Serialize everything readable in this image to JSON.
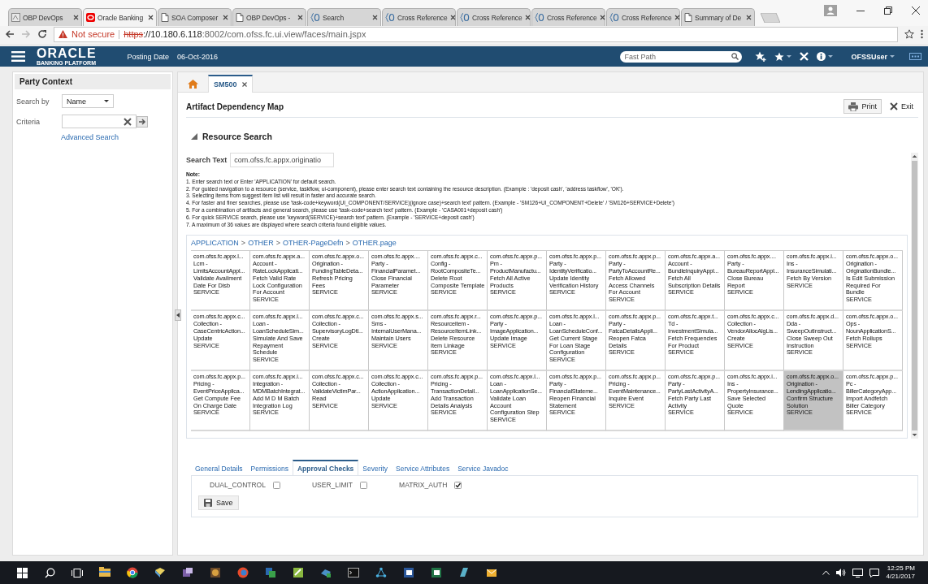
{
  "browser": {
    "tabs": [
      {
        "title": "OBP DevOps",
        "kind": "generic",
        "selected": false
      },
      {
        "title": "Oracle Banking",
        "kind": "oracle",
        "selected": true
      },
      {
        "title": "SOA Composer",
        "kind": "page",
        "selected": false
      },
      {
        "title": "OBP DevOps -",
        "kind": "page",
        "selected": false
      },
      {
        "title": "Search",
        "kind": "brace",
        "selected": false
      },
      {
        "title": "Cross Reference",
        "kind": "brace",
        "selected": false
      },
      {
        "title": "Cross Reference",
        "kind": "brace",
        "selected": false
      },
      {
        "title": "Cross Reference",
        "kind": "brace",
        "selected": false
      },
      {
        "title": "Cross Reference",
        "kind": "brace",
        "selected": false
      },
      {
        "title": "Summary of De",
        "kind": "page",
        "selected": false
      }
    ],
    "security_warning": "Not secure",
    "url_scheme": "https",
    "url_host": "://10.180.6.118",
    "url_path": ":8002/com.ofss.fc.ui.view/faces/main.jspx"
  },
  "app_header": {
    "logo": "ORACLE",
    "logo_subtitle": "BANKING PLATFORM",
    "posting_date_label": "Posting Date",
    "posting_date": "06-Oct-2016",
    "fast_path": {
      "placeholder": "Fast Path"
    },
    "user": "OFSSUser"
  },
  "party_context": {
    "title": "Party Context",
    "search_by_label": "Search by",
    "search_by_value": "Name",
    "criteria_label": "Criteria",
    "advanced_search": "Advanced Search"
  },
  "workspace_tabs": [
    {
      "kind": "home",
      "selected": false
    },
    {
      "kind": "page",
      "label": "SM500",
      "selected": true
    }
  ],
  "page": {
    "title": "Artifact Dependency Map",
    "buttons": [
      {
        "label": "Print",
        "kind": "print"
      },
      {
        "label": "Exit",
        "kind": "exit"
      }
    ],
    "section": {
      "title": "Resource Search",
      "expanded": true
    },
    "search_text": {
      "label": "Search Text",
      "value": "com.ofss.fc.appx.originatio"
    },
    "note_heading": "Note:",
    "notes": [
      "1. Enter search text or Enter 'APPLICATION' for default search.",
      "2. For guided navigation to a resource (service, taskflow, ui-component), please enter search text containing the resource description. (Example : 'deposit cash', 'address taskflow', 'OK').",
      "3. Selecting items from suggest item list will result in faster and accurate search.",
      "4. For faster and finer searches, please use 'task-code+keyword(UI_COMPONENT/SERVICE)(ignore case)+search text' pattern. (Example - 'SM126+UI_COMPONENT+Delete' / 'SM126+SERVICE+Delete')",
      "5. For a combination of artifacts and general search, please use 'task-code+search text' pattern. (Example - 'CASA001+deposit cash')",
      "6. For quick SERVICE search, please use 'keyword(SERVICE)+search text' pattern. (Example - 'SERVICE+deposit cash')",
      "7. A maximum of 36 values are displayed where search criteria found eligible values."
    ],
    "breadcrumb": {
      "items": [
        "APPLICATION",
        "OTHER",
        "OTHER-PageDefn",
        "OTHER.page"
      ],
      "separator": ">"
    },
    "artifacts": [
      {
        "package": "com.ofss.fc.appx.l...",
        "module": "Lcm -",
        "component": "LimitsAccountAppl...",
        "operation": "Validate Availment Date For Disb",
        "type": "SERVICE",
        "selected": false
      },
      {
        "package": "com.ofss.fc.appx.a...",
        "module": "Account -",
        "component": "RateLockApplicati...",
        "operation": "Fetch Valid Rate Lock Configuration For Account",
        "type": "SERVICE",
        "selected": false
      },
      {
        "package": "com.ofss.fc.appx.o...",
        "module": "Origination -",
        "component": "FundingTableDeta...",
        "operation": "Refresh Pricing Fees",
        "type": "SERVICE",
        "selected": false
      },
      {
        "package": "com.ofss.fc.appx....",
        "module": "Party -",
        "component": "FinancialParamet...",
        "operation": "Close Financial Parameter",
        "type": "SERVICE",
        "selected": false
      },
      {
        "package": "com.ofss.fc.appx.c...",
        "module": "Config -",
        "component": "RootCompositeTe...",
        "operation": "Delete Root Composite Template",
        "type": "SERVICE",
        "selected": false
      },
      {
        "package": "com.ofss.fc.appx.p...",
        "module": "Pm -",
        "component": "ProductManufactu...",
        "operation": "Fetch All Active Products",
        "type": "SERVICE",
        "selected": false
      },
      {
        "package": "com.ofss.fc.appx.p...",
        "module": "Party -",
        "component": "IdentityVerificatio...",
        "operation": "Update Identity Verification History",
        "type": "SERVICE",
        "selected": false
      },
      {
        "package": "com.ofss.fc.appx.p...",
        "module": "Party -",
        "component": "PartyToAccountRe...",
        "operation": "Fetch Allowed Access Channels For Account",
        "type": "SERVICE",
        "selected": false
      },
      {
        "package": "com.ofss.fc.appx.a...",
        "module": "Account -",
        "component": "BundleInquiryAppl...",
        "operation": "Fetch All Subscription Details",
        "type": "SERVICE",
        "selected": false
      },
      {
        "package": "com.ofss.fc.appx....",
        "module": "Party -",
        "component": "BureauReportAppl...",
        "operation": "Close Bureau Report",
        "type": "SERVICE",
        "selected": false
      },
      {
        "package": "com.ofss.fc.appx.i...",
        "module": "Ins -",
        "component": "InsuranceSimulati...",
        "operation": "Fetch By Version",
        "type": "SERVICE",
        "selected": false
      },
      {
        "package": "com.ofss.fc.appx.o...",
        "module": "Origination -",
        "component": "OriginationBundle...",
        "operation": "Is Edit Submission Required For Bundle",
        "type": "SERVICE",
        "selected": false
      },
      {
        "package": "com.ofss.fc.appx.c...",
        "module": "Collection -",
        "component": "CaseCentricAction...",
        "operation": "Update",
        "type": "SERVICE",
        "selected": false
      },
      {
        "package": "com.ofss.fc.appx.l...",
        "module": "Loan -",
        "component": "LoanScheduleSim...",
        "operation": "Simulate And Save Repayment Schedule",
        "type": "SERVICE",
        "selected": false
      },
      {
        "package": "com.ofss.fc.appx.c...",
        "module": "Collection -",
        "component": "SupervisoryLogDtl...",
        "operation": "Create",
        "type": "SERVICE",
        "selected": false
      },
      {
        "package": "com.ofss.fc.appx.s...",
        "module": "Sms -",
        "component": "InternalUserMana...",
        "operation": "Maintain Users",
        "type": "SERVICE",
        "selected": false
      },
      {
        "package": "com.ofss.fc.appx.r...",
        "module": "Resourceitem -",
        "component": "ResourceItemLink...",
        "operation": "Delete Resource Item Linkage",
        "type": "SERVICE",
        "selected": false
      },
      {
        "package": "com.ofss.fc.appx.p...",
        "module": "Party -",
        "component": "ImageApplication...",
        "operation": "Update Image",
        "type": "SERVICE",
        "selected": false
      },
      {
        "package": "com.ofss.fc.appx.l...",
        "module": "Loan -",
        "component": "LoanScheduleConf...",
        "operation": "Get Current Stage For Loan Stage Configuration",
        "type": "SERVICE",
        "selected": false
      },
      {
        "package": "com.ofss.fc.appx.p...",
        "module": "Party -",
        "component": "FatcaDetailsAppli...",
        "operation": "Reopen Fatca Details",
        "type": "SERVICE",
        "selected": false
      },
      {
        "package": "com.ofss.fc.appx.t...",
        "module": "Td -",
        "component": "InvestmentSimula...",
        "operation": "Fetch Frequencies For Product",
        "type": "SERVICE",
        "selected": false
      },
      {
        "package": "com.ofss.fc.appx.c...",
        "module": "Collection -",
        "component": "VendorAllocAlgLis...",
        "operation": "Create",
        "type": "SERVICE",
        "selected": false
      },
      {
        "package": "com.ofss.fc.appx.d...",
        "module": "Dda -",
        "component": "SweepOutInstruct...",
        "operation": "Close Sweep Out Instruction",
        "type": "SERVICE",
        "selected": false
      },
      {
        "package": "com.ofss.fc.appx.o...",
        "module": "Ops -",
        "component": "NounApplicationS...",
        "operation": "Fetch Rollups",
        "type": "SERVICE",
        "selected": false
      },
      {
        "package": "com.ofss.fc.appx.p...",
        "module": "Pricing -",
        "component": "EventPriceApplica...",
        "operation": "Get Compute Fee On Charge Date",
        "type": "SERVICE",
        "selected": false
      },
      {
        "package": "com.ofss.fc.appx.i...",
        "module": "Integration -",
        "component": "MDMBatchIntegrat...",
        "operation": "Add M D M Batch Integration Log",
        "type": "SERVICE",
        "selected": false
      },
      {
        "package": "com.ofss.fc.appx.c...",
        "module": "Collection -",
        "component": "ValidateVictimPar...",
        "operation": "Read",
        "type": "SERVICE",
        "selected": false
      },
      {
        "package": "com.ofss.fc.appx.c...",
        "module": "Collection -",
        "component": "ActionApplication...",
        "operation": "Update",
        "type": "SERVICE",
        "selected": false
      },
      {
        "package": "com.ofss.fc.appx.p...",
        "module": "Pricing -",
        "component": "TransactionDetail...",
        "operation": "Add Transaction Details Analysis",
        "type": "SERVICE",
        "selected": false
      },
      {
        "package": "com.ofss.fc.appx.l...",
        "module": "Loan -",
        "component": "LoanApplicationSe...",
        "operation": "Validate Loan Account Configuration Step",
        "type": "SERVICE",
        "selected": false
      },
      {
        "package": "com.ofss.fc.appx.p...",
        "module": "Party -",
        "component": "FinancialStateme...",
        "operation": "Reopen Financial Statement",
        "type": "SERVICE",
        "selected": false
      },
      {
        "package": "com.ofss.fc.appx.p...",
        "module": "Pricing -",
        "component": "EventMaintenance...",
        "operation": "Inquire Event",
        "type": "SERVICE",
        "selected": false
      },
      {
        "package": "com.ofss.fc.appx.p...",
        "module": "Party -",
        "component": "PartyLastActivityA...",
        "operation": "Fetch Party Last Activity",
        "type": "SERVICE",
        "selected": false
      },
      {
        "package": "com.ofss.fc.appx.i...",
        "module": "Ins -",
        "component": "PropertyInsurance...",
        "operation": "Save Selected Quote",
        "type": "SERVICE",
        "selected": false
      },
      {
        "package": "com.ofss.fc.appx.o...",
        "module": "Origination -",
        "component": "LendingApplicatio...",
        "operation": "Confirm Structure Solution",
        "type": "SERVICE",
        "selected": true
      },
      {
        "package": "com.ofss.fc.appx.p...",
        "module": "Pc -",
        "component": "BillerCategoryApp...",
        "operation": "Import Andfetch Biller Category",
        "type": "SERVICE",
        "selected": false
      }
    ],
    "detail_tabs": [
      {
        "label": "General Details",
        "selected": false
      },
      {
        "label": "Permissions",
        "selected": false
      },
      {
        "label": "Approval Checks",
        "selected": true
      },
      {
        "label": "Severity",
        "selected": false
      },
      {
        "label": "Service Attributes",
        "selected": false
      },
      {
        "label": "Service Javadoc",
        "selected": false
      }
    ],
    "approval_checks": [
      {
        "label": "DUAL_CONTROL",
        "checked": false
      },
      {
        "label": "USER_LIMIT",
        "checked": false
      },
      {
        "label": "MATRIX_AUTH",
        "checked": true
      }
    ],
    "save_button": "Save"
  },
  "taskbar": {
    "time": "12:25 PM",
    "date": "4/21/2017"
  }
}
